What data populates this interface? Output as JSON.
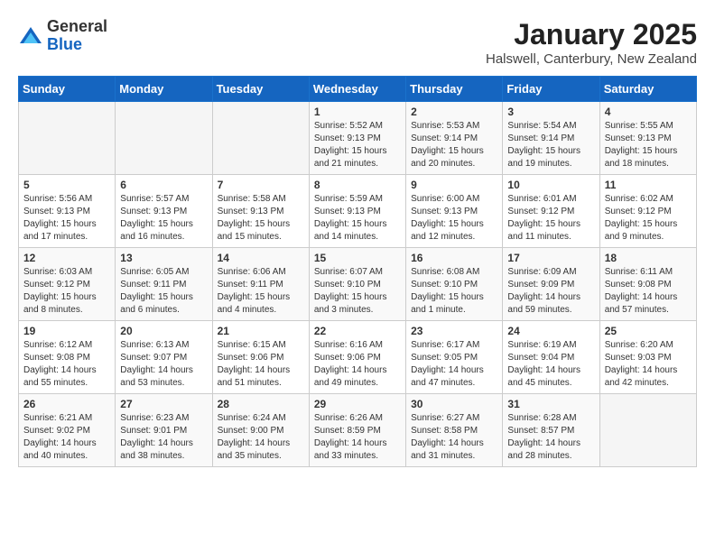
{
  "logo": {
    "general": "General",
    "blue": "Blue"
  },
  "title": {
    "month": "January 2025",
    "location": "Halswell, Canterbury, New Zealand"
  },
  "weekdays": [
    "Sunday",
    "Monday",
    "Tuesday",
    "Wednesday",
    "Thursday",
    "Friday",
    "Saturday"
  ],
  "weeks": [
    [
      {
        "day": "",
        "info": ""
      },
      {
        "day": "",
        "info": ""
      },
      {
        "day": "",
        "info": ""
      },
      {
        "day": "1",
        "info": "Sunrise: 5:52 AM\nSunset: 9:13 PM\nDaylight: 15 hours\nand 21 minutes."
      },
      {
        "day": "2",
        "info": "Sunrise: 5:53 AM\nSunset: 9:14 PM\nDaylight: 15 hours\nand 20 minutes."
      },
      {
        "day": "3",
        "info": "Sunrise: 5:54 AM\nSunset: 9:14 PM\nDaylight: 15 hours\nand 19 minutes."
      },
      {
        "day": "4",
        "info": "Sunrise: 5:55 AM\nSunset: 9:13 PM\nDaylight: 15 hours\nand 18 minutes."
      }
    ],
    [
      {
        "day": "5",
        "info": "Sunrise: 5:56 AM\nSunset: 9:13 PM\nDaylight: 15 hours\nand 17 minutes."
      },
      {
        "day": "6",
        "info": "Sunrise: 5:57 AM\nSunset: 9:13 PM\nDaylight: 15 hours\nand 16 minutes."
      },
      {
        "day": "7",
        "info": "Sunrise: 5:58 AM\nSunset: 9:13 PM\nDaylight: 15 hours\nand 15 minutes."
      },
      {
        "day": "8",
        "info": "Sunrise: 5:59 AM\nSunset: 9:13 PM\nDaylight: 15 hours\nand 14 minutes."
      },
      {
        "day": "9",
        "info": "Sunrise: 6:00 AM\nSunset: 9:13 PM\nDaylight: 15 hours\nand 12 minutes."
      },
      {
        "day": "10",
        "info": "Sunrise: 6:01 AM\nSunset: 9:12 PM\nDaylight: 15 hours\nand 11 minutes."
      },
      {
        "day": "11",
        "info": "Sunrise: 6:02 AM\nSunset: 9:12 PM\nDaylight: 15 hours\nand 9 minutes."
      }
    ],
    [
      {
        "day": "12",
        "info": "Sunrise: 6:03 AM\nSunset: 9:12 PM\nDaylight: 15 hours\nand 8 minutes."
      },
      {
        "day": "13",
        "info": "Sunrise: 6:05 AM\nSunset: 9:11 PM\nDaylight: 15 hours\nand 6 minutes."
      },
      {
        "day": "14",
        "info": "Sunrise: 6:06 AM\nSunset: 9:11 PM\nDaylight: 15 hours\nand 4 minutes."
      },
      {
        "day": "15",
        "info": "Sunrise: 6:07 AM\nSunset: 9:10 PM\nDaylight: 15 hours\nand 3 minutes."
      },
      {
        "day": "16",
        "info": "Sunrise: 6:08 AM\nSunset: 9:10 PM\nDaylight: 15 hours\nand 1 minute."
      },
      {
        "day": "17",
        "info": "Sunrise: 6:09 AM\nSunset: 9:09 PM\nDaylight: 14 hours\nand 59 minutes."
      },
      {
        "day": "18",
        "info": "Sunrise: 6:11 AM\nSunset: 9:08 PM\nDaylight: 14 hours\nand 57 minutes."
      }
    ],
    [
      {
        "day": "19",
        "info": "Sunrise: 6:12 AM\nSunset: 9:08 PM\nDaylight: 14 hours\nand 55 minutes."
      },
      {
        "day": "20",
        "info": "Sunrise: 6:13 AM\nSunset: 9:07 PM\nDaylight: 14 hours\nand 53 minutes."
      },
      {
        "day": "21",
        "info": "Sunrise: 6:15 AM\nSunset: 9:06 PM\nDaylight: 14 hours\nand 51 minutes."
      },
      {
        "day": "22",
        "info": "Sunrise: 6:16 AM\nSunset: 9:06 PM\nDaylight: 14 hours\nand 49 minutes."
      },
      {
        "day": "23",
        "info": "Sunrise: 6:17 AM\nSunset: 9:05 PM\nDaylight: 14 hours\nand 47 minutes."
      },
      {
        "day": "24",
        "info": "Sunrise: 6:19 AM\nSunset: 9:04 PM\nDaylight: 14 hours\nand 45 minutes."
      },
      {
        "day": "25",
        "info": "Sunrise: 6:20 AM\nSunset: 9:03 PM\nDaylight: 14 hours\nand 42 minutes."
      }
    ],
    [
      {
        "day": "26",
        "info": "Sunrise: 6:21 AM\nSunset: 9:02 PM\nDaylight: 14 hours\nand 40 minutes."
      },
      {
        "day": "27",
        "info": "Sunrise: 6:23 AM\nSunset: 9:01 PM\nDaylight: 14 hours\nand 38 minutes."
      },
      {
        "day": "28",
        "info": "Sunrise: 6:24 AM\nSunset: 9:00 PM\nDaylight: 14 hours\nand 35 minutes."
      },
      {
        "day": "29",
        "info": "Sunrise: 6:26 AM\nSunset: 8:59 PM\nDaylight: 14 hours\nand 33 minutes."
      },
      {
        "day": "30",
        "info": "Sunrise: 6:27 AM\nSunset: 8:58 PM\nDaylight: 14 hours\nand 31 minutes."
      },
      {
        "day": "31",
        "info": "Sunrise: 6:28 AM\nSunset: 8:57 PM\nDaylight: 14 hours\nand 28 minutes."
      },
      {
        "day": "",
        "info": ""
      }
    ]
  ]
}
